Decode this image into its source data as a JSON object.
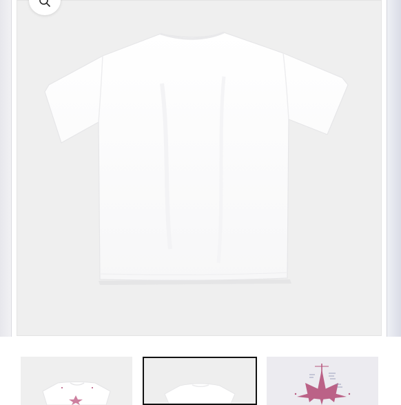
{
  "gallery": {
    "zoom_icon": "magnifier-icon",
    "main_image": "white-tshirt-back-view",
    "colors": {
      "slide_bg": "#efefef",
      "shirt": "#ffffff",
      "active_thumb_border": "#111111",
      "print_accent": "#b04a74"
    }
  },
  "thumbnails": [
    {
      "image": "white-tshirt-front-with-star-print",
      "selected": false
    },
    {
      "image": "white-tshirt-back-view",
      "selected": true
    },
    {
      "image": "star-print-detail",
      "selected": false
    }
  ]
}
